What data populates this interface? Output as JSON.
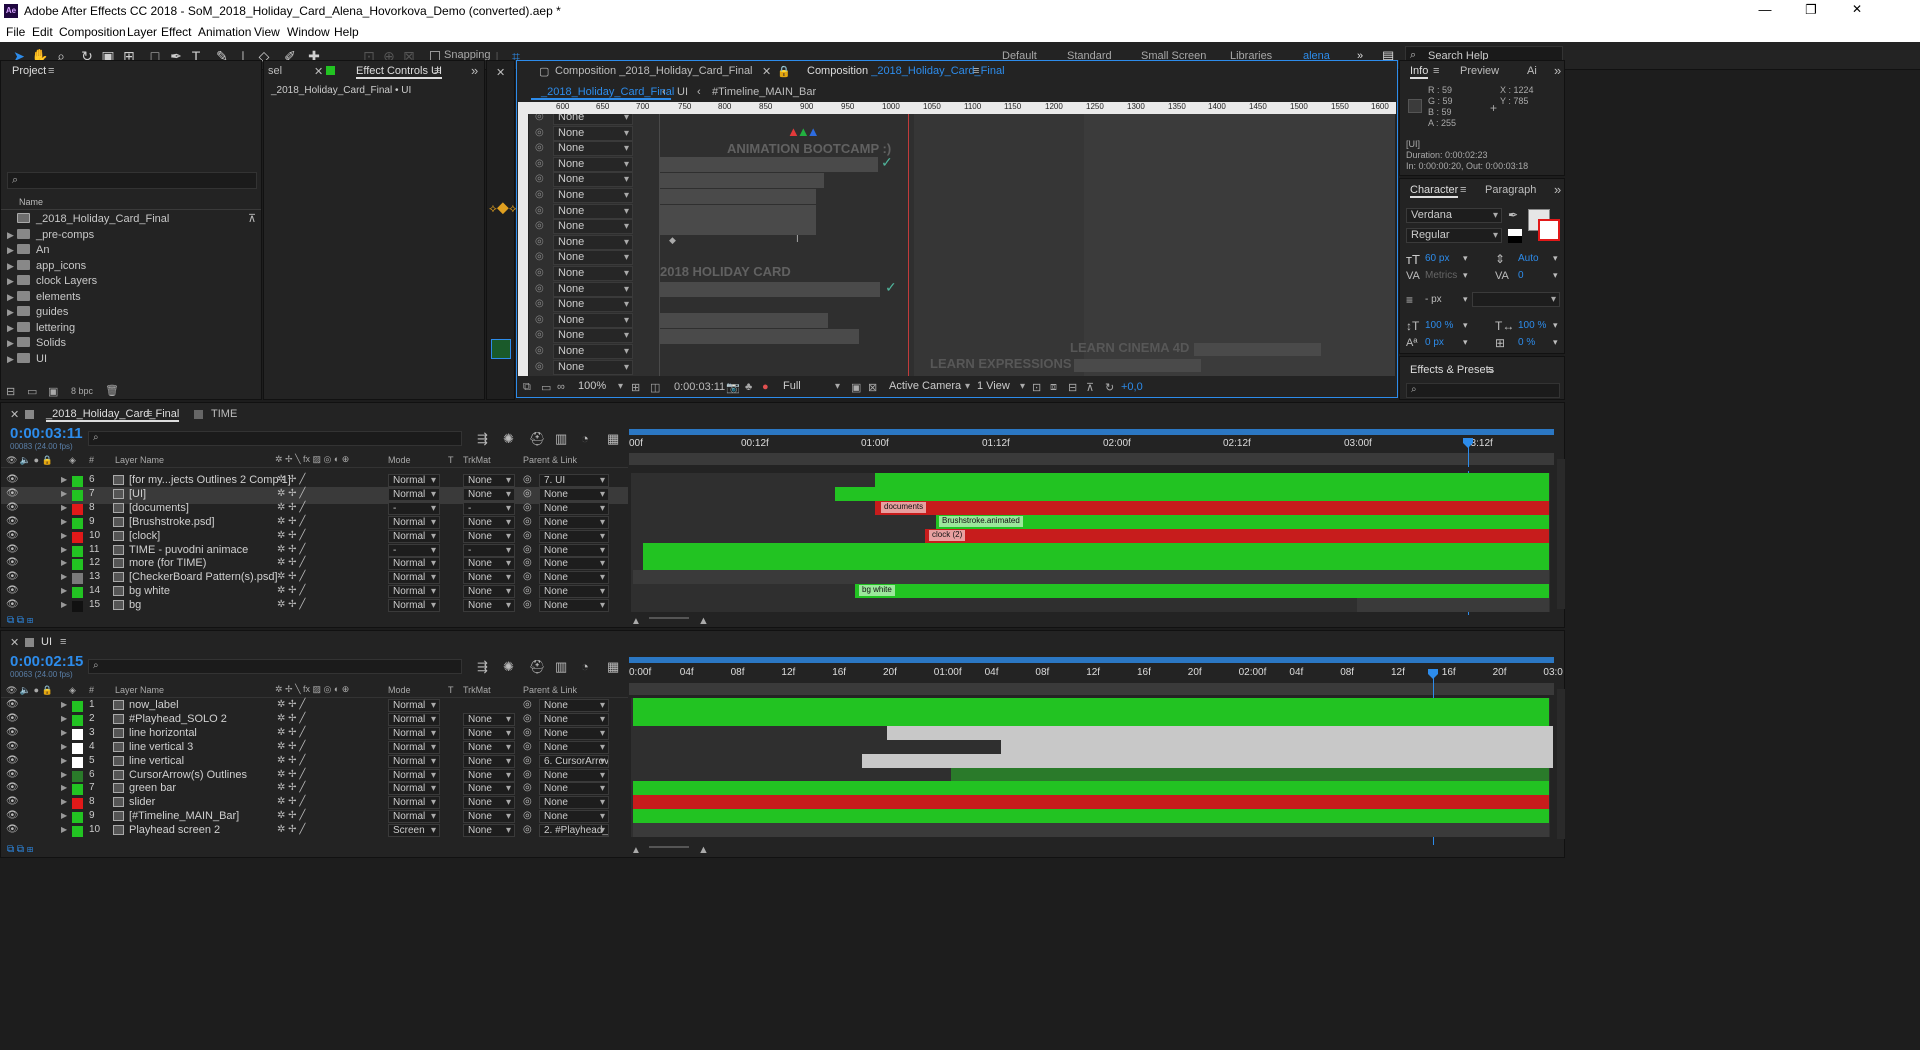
{
  "app": {
    "icon_label": "Ae",
    "title": "Adobe After Effects CC 2018 - SoM_2018_Holiday_Card_Alena_Hovorkova_Demo (converted).aep *",
    "window_controls": [
      "—",
      "❐",
      "✕"
    ]
  },
  "menu": [
    "File",
    "Edit",
    "Composition",
    "Layer",
    "Effect",
    "Animation",
    "View",
    "Window",
    "Help"
  ],
  "toolbar": {
    "snapping": "Snapping",
    "workspaces": [
      "Default",
      "Standard",
      "Small Screen",
      "Libraries",
      "alena"
    ],
    "search_help": "Search Help"
  },
  "project": {
    "tab": "Project",
    "search_placeholder": "",
    "name_header": "Name",
    "items": [
      "_2018_Holiday_Card_Final",
      "_pre-comps",
      "An",
      "app_icons",
      "clock Layers",
      "elements",
      "guides",
      "lettering",
      "Solids",
      "UI"
    ],
    "bpc": "8 bpc"
  },
  "effect_controls": {
    "tab_left": "sel",
    "tab": "Effect Controls UI",
    "subtitle": "_2018_Holiday_Card_Final • UI"
  },
  "composition": {
    "tab1": "Composition _2018_Holiday_Card_Final",
    "tab2_prefix": "Composition ",
    "tab2_name": "_2018_Holiday_Card_Final",
    "breadcrumbs": [
      "_2018_Holiday_Card_Final",
      "UI",
      "#Timeline_MAIN_Bar"
    ],
    "ruler": [
      "600",
      "650",
      "700",
      "750",
      "800",
      "850",
      "900",
      "950",
      "1000",
      "1050",
      "1100",
      "1150",
      "1200",
      "1250",
      "1300",
      "1350",
      "1400",
      "1450",
      "1500",
      "1550",
      "1600"
    ],
    "none_label": "None",
    "text_animation_bootcamp": "ANIMATION BOOTCAMP :)",
    "text_holiday_card": "2018 HOLIDAY CARD",
    "text_learn_cinema": "LEARN CINEMA 4D",
    "text_learn_expressions": "LEARN EXPRESSIONS",
    "footer": {
      "zoom": "100%",
      "timecode": "0:00:03:11",
      "resolution": "Full",
      "camera": "Active Camera",
      "view": "1 View",
      "exposure": "+0,0"
    }
  },
  "info": {
    "tab": "Info",
    "tab2": "Preview",
    "tab3": "Ai",
    "r": "R : 59",
    "g": "G : 59",
    "b": "B : 59",
    "a": "A : 255",
    "x": "X : 1224",
    "y": "Y : 785",
    "layer": "[UI]",
    "duration": "Duration: 0:00:02:23",
    "inout": "In: 0:00:00:20, Out: 0:00:03:18"
  },
  "character": {
    "tab": "Character",
    "tab2": "Paragraph",
    "font": "Verdana",
    "style": "Regular",
    "size": "60 px",
    "leading": "Auto",
    "kerning": "Metrics",
    "tracking": "0",
    "stroke": "- px",
    "vscale": "100 %",
    "hscale": "100 %",
    "baseline": "0 px",
    "tsume": "0 %"
  },
  "effects_presets": {
    "tab": "Effects & Presets"
  },
  "timeline_main": {
    "tab": "_2018_Holiday_Card_Final",
    "tab2": "TIME",
    "timecode": "0:00:03:11",
    "frames": "00083 (24.00 fps)",
    "headers": {
      "layer_name": "Layer Name",
      "mode": "Mode",
      "t": "T",
      "trkmat": "TrkMat",
      "parent": "Parent & Link"
    },
    "ruler": [
      "00f",
      "00:12f",
      "01:00f",
      "01:12f",
      "02:00f",
      "02:12f",
      "03:00f",
      "03:12f"
    ],
    "layers": [
      {
        "num": "6",
        "name": "[for my...jects Outlines 2 Comp 1]",
        "label": "#22c322",
        "mode": "Normal",
        "trkmat": "None",
        "parent": "7. UI"
      },
      {
        "num": "7",
        "name": "[UI]",
        "label": "#22c322",
        "mode": "Normal",
        "trkmat": "None",
        "parent": "None"
      },
      {
        "num": "8",
        "name": "[documents]",
        "label": "#e11919",
        "mode": "-",
        "trkmat": "-",
        "parent": "None"
      },
      {
        "num": "9",
        "name": "[Brushstroke.psd]",
        "label": "#22c322",
        "mode": "Normal",
        "trkmat": "None",
        "parent": "None"
      },
      {
        "num": "10",
        "name": "[clock]",
        "label": "#e11919",
        "mode": "Normal",
        "trkmat": "None",
        "parent": "None"
      },
      {
        "num": "11",
        "name": "TIME - puvodni animace",
        "label": "#22c322",
        "mode": "-",
        "trkmat": "-",
        "parent": "None"
      },
      {
        "num": "12",
        "name": "more (for TIME)",
        "label": "#22c322",
        "mode": "Normal",
        "trkmat": "None",
        "parent": "None"
      },
      {
        "num": "13",
        "name": "[CheckerBoard Pattern(s).psd]",
        "label": "#7a7a7a",
        "mode": "Normal",
        "trkmat": "None",
        "parent": "None"
      },
      {
        "num": "14",
        "name": "bg white",
        "label": "#22c322",
        "mode": "Normal",
        "trkmat": "None",
        "parent": "None"
      },
      {
        "num": "15",
        "name": "bg",
        "label": "#111111",
        "mode": "Normal",
        "trkmat": "None",
        "parent": "None"
      }
    ],
    "bar_labels": {
      "documents": "documents",
      "brushstroke": "Brushstroke.animated",
      "clock": "clock (2)",
      "bgwhite": "bg white"
    }
  },
  "timeline_ui": {
    "tab": "UI",
    "timecode": "0:00:02:15",
    "frames": "00063 (24.00 fps)",
    "ruler": [
      "0:00f",
      "04f",
      "08f",
      "12f",
      "16f",
      "20f",
      "01:00f",
      "04f",
      "08f",
      "12f",
      "16f",
      "20f",
      "02:00f",
      "04f",
      "08f",
      "12f",
      "16f",
      "20f",
      "03:0"
    ],
    "layers": [
      {
        "num": "1",
        "name": "now_label",
        "label": "#22c322",
        "mode": "Normal",
        "trkmat": "",
        "parent": "None"
      },
      {
        "num": "2",
        "name": "#Playhead_SOLO 2",
        "label": "#22c322",
        "mode": "Normal",
        "trkmat": "None",
        "parent": "None"
      },
      {
        "num": "3",
        "name": "line horizontal",
        "label": "#ffffff",
        "mode": "Normal",
        "trkmat": "None",
        "parent": "None"
      },
      {
        "num": "4",
        "name": "line vertical 3",
        "label": "#ffffff",
        "mode": "Normal",
        "trkmat": "None",
        "parent": "None"
      },
      {
        "num": "5",
        "name": "line vertical",
        "label": "#ffffff",
        "mode": "Normal",
        "trkmat": "None",
        "parent": "6. CursorArrov"
      },
      {
        "num": "6",
        "name": "CursorArrow(s) Outlines",
        "label": "#2a7a2a",
        "mode": "Normal",
        "trkmat": "None",
        "parent": "None"
      },
      {
        "num": "7",
        "name": "green bar",
        "label": "#22c322",
        "mode": "Normal",
        "trkmat": "None",
        "parent": "None"
      },
      {
        "num": "8",
        "name": "slider",
        "label": "#e11919",
        "mode": "Normal",
        "trkmat": "None",
        "parent": "None"
      },
      {
        "num": "9",
        "name": "[#Timeline_MAIN_Bar]",
        "label": "#22c322",
        "mode": "Normal",
        "trkmat": "None",
        "parent": "None"
      },
      {
        "num": "10",
        "name": "Playhead screen 2",
        "label": "#22c322",
        "mode": "Screen",
        "trkmat": "None",
        "parent": "2. #Playhead_"
      }
    ]
  },
  "colors": {
    "accent_blue": "#2d8ceb",
    "green": "#22c322",
    "red": "#c71c1c",
    "panel": "#232323"
  }
}
